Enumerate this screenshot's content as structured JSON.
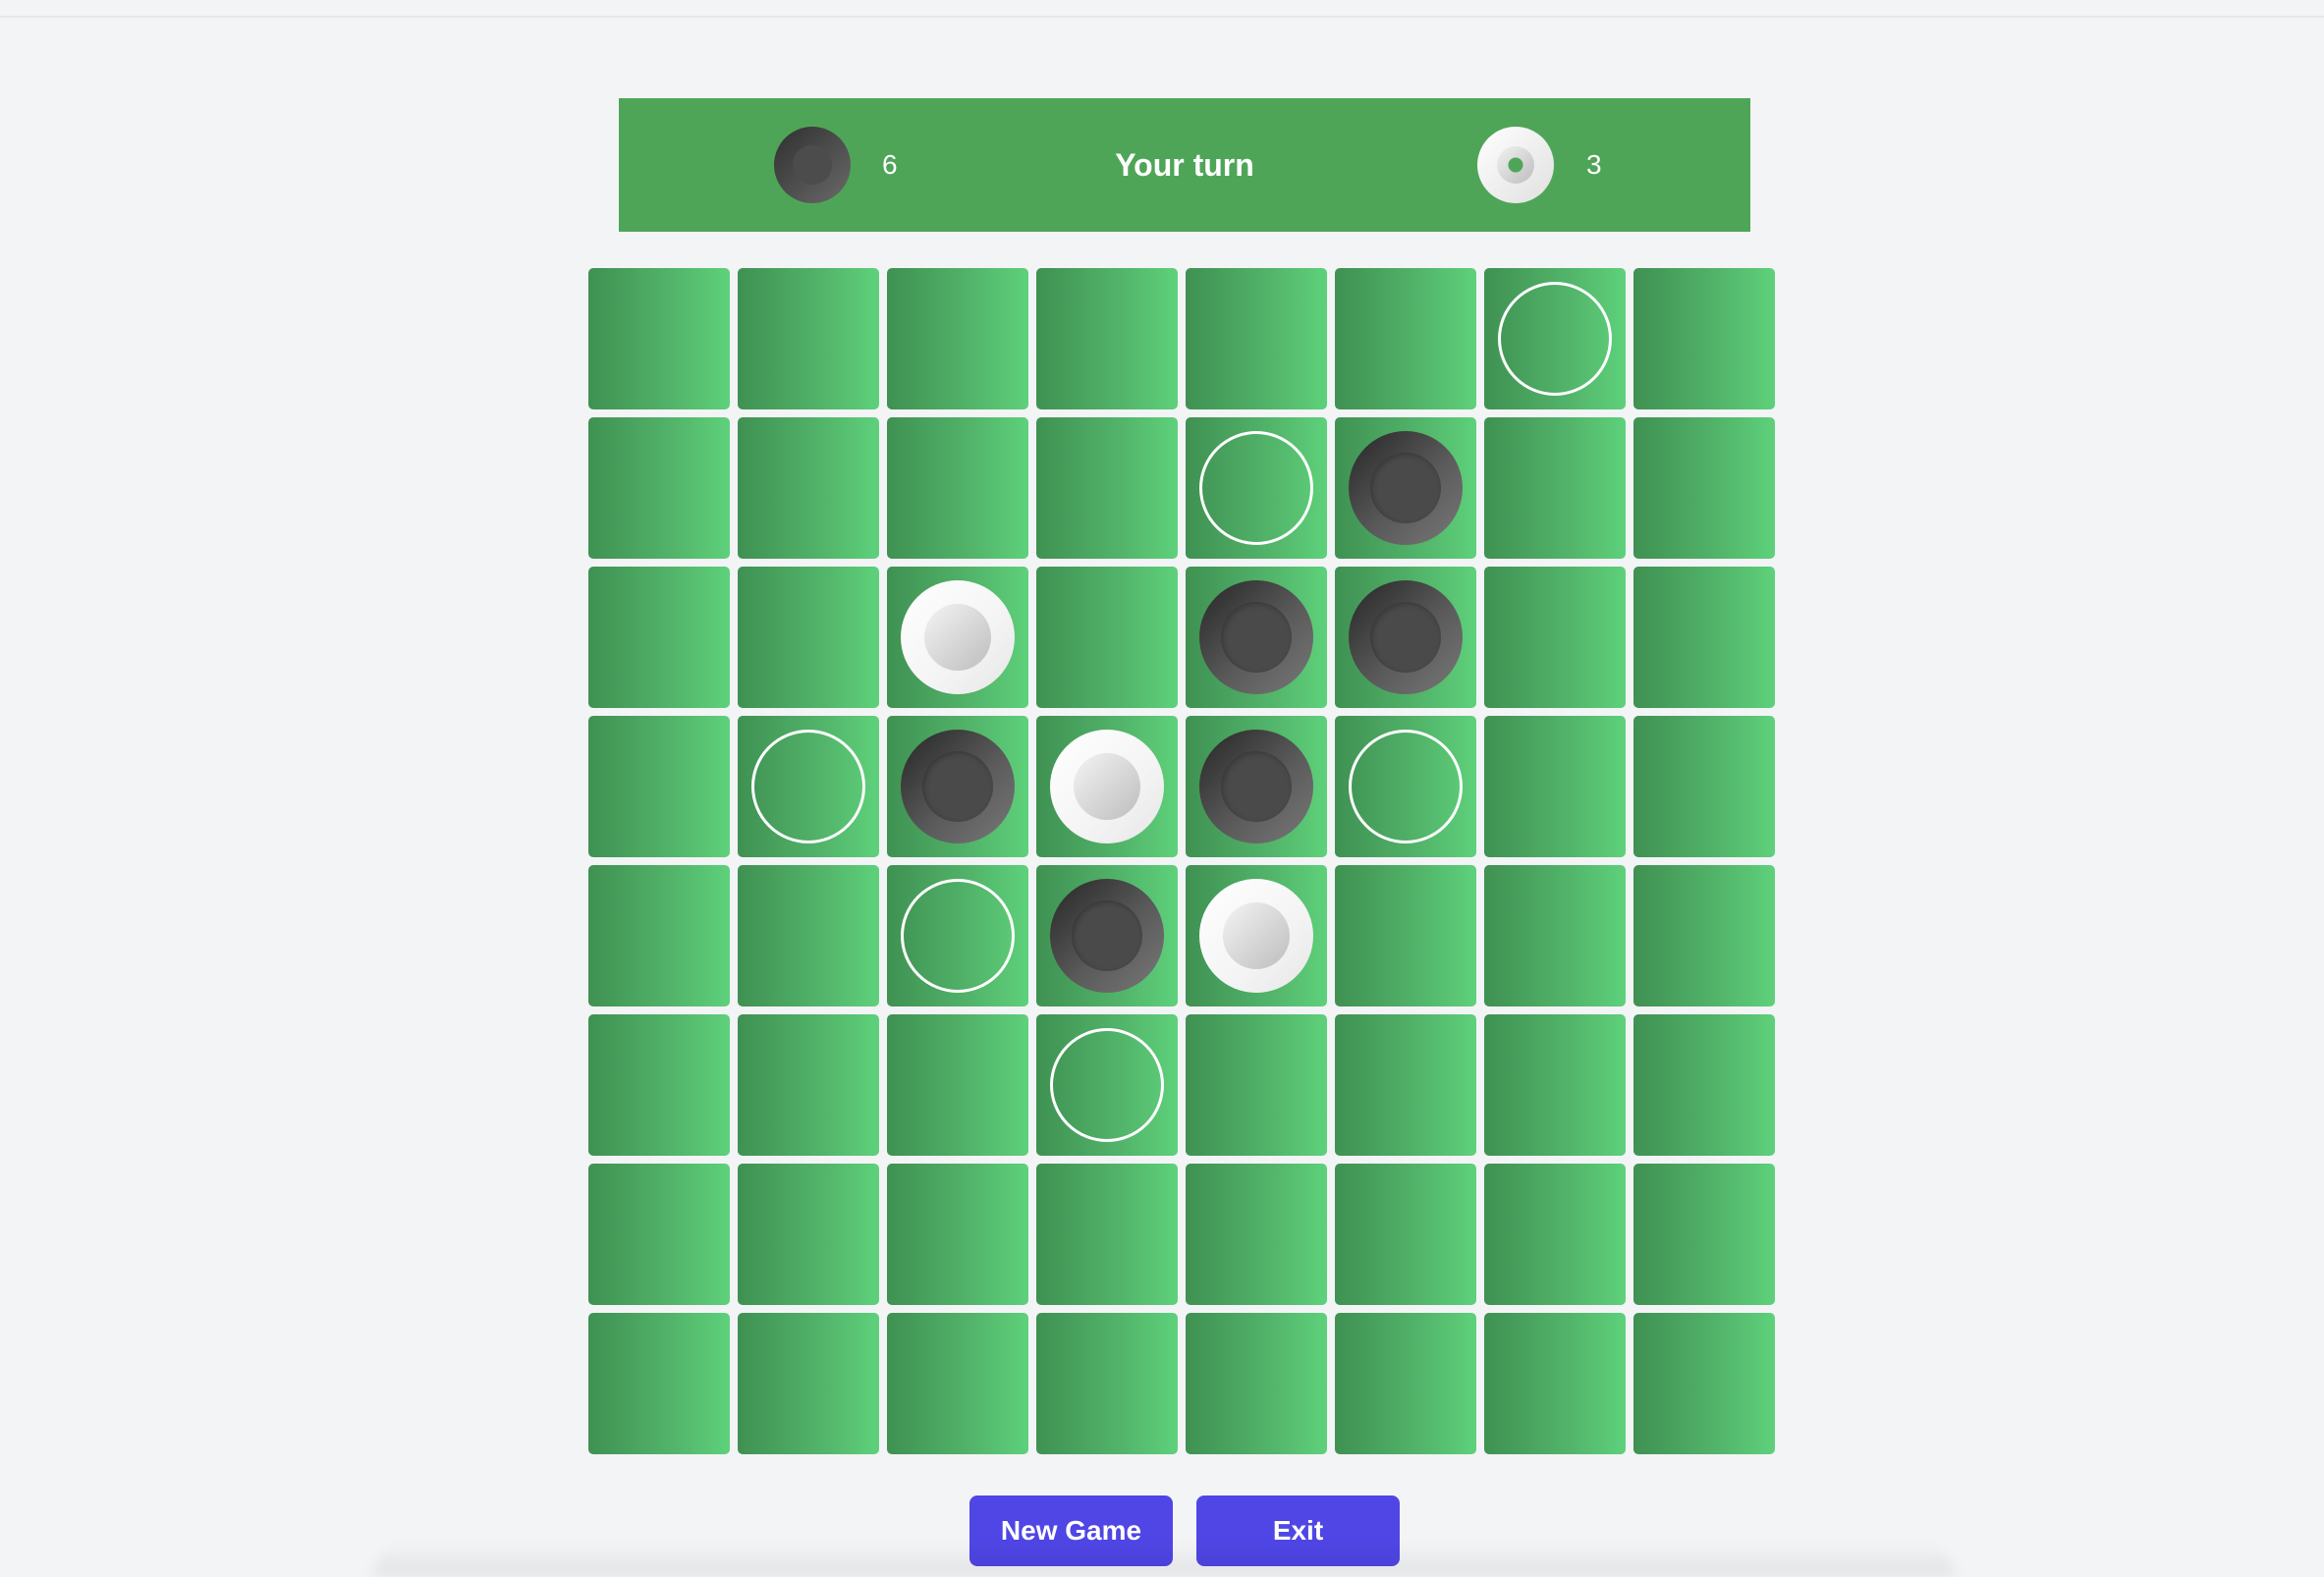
{
  "scorebar": {
    "black_count": "6",
    "turn_text": "Your turn",
    "white_count": "3"
  },
  "board": {
    "rows": [
      [
        "",
        "",
        "",
        "",
        "",
        "",
        "hint",
        ""
      ],
      [
        "",
        "",
        "",
        "",
        "hint",
        "black",
        "",
        ""
      ],
      [
        "",
        "",
        "white",
        "",
        "black",
        "black",
        "",
        ""
      ],
      [
        "",
        "hint",
        "black",
        "white",
        "black",
        "hint",
        "",
        ""
      ],
      [
        "",
        "",
        "hint",
        "black",
        "white",
        "",
        "",
        ""
      ],
      [
        "",
        "",
        "",
        "hint",
        "",
        "",
        "",
        ""
      ],
      [
        "",
        "",
        "",
        "",
        "",
        "",
        "",
        ""
      ],
      [
        "",
        "",
        "",
        "",
        "",
        "",
        "",
        ""
      ]
    ]
  },
  "buttons": {
    "new_game": "New Game",
    "exit": "Exit"
  },
  "colors": {
    "scorebar_bg": "#4fa557",
    "button_bg": "#4f46e5",
    "page_bg": "#f3f4f6"
  }
}
